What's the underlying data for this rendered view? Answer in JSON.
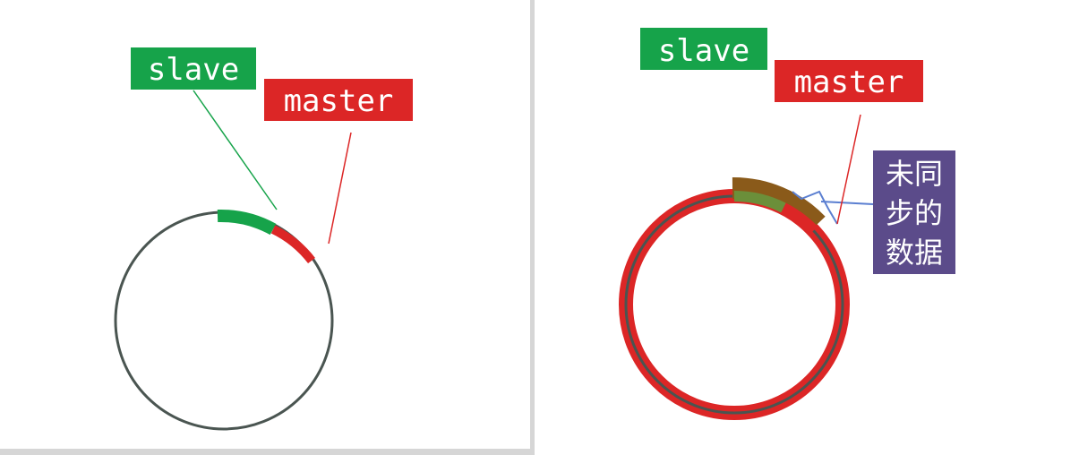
{
  "left_panel": {
    "slave_label": "slave",
    "master_label": "master"
  },
  "right_panel": {
    "slave_label": "slave",
    "master_label": "master",
    "unsynced_label_lines": [
      "未同",
      "步的",
      "数据"
    ]
  },
  "colors": {
    "slave_green": "#16a34a",
    "master_red": "#dc2626",
    "ring_gray": "#4a5551",
    "brace_blue": "#5b7fd1",
    "unsynced_purple": "#5b4b8a",
    "overlap_brown": "#8a5a1a"
  }
}
